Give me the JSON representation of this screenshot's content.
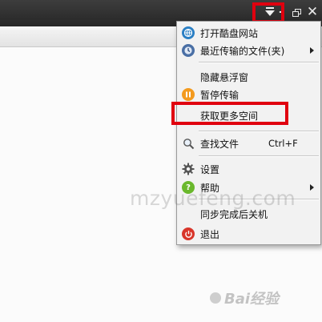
{
  "window_controls": {
    "menu": "dropdown-menu-icon",
    "minimize_label": "-",
    "restore": "restore-icon",
    "close_label": "✕"
  },
  "menu": {
    "items": [
      {
        "label": "打开酷盘网站",
        "icon": "globe-icon",
        "color": "#2a7fc4"
      },
      {
        "label": "最近传输的文件(夹)",
        "icon": "clock-icon",
        "color": "#4a6fa5",
        "submenu": true
      },
      {
        "label": "隐藏悬浮窗"
      },
      {
        "label": "暂停传输",
        "icon": "pause-icon",
        "color": "#f39a1e"
      },
      {
        "label": "获取更多空间"
      },
      {
        "label": "查找文件",
        "shortcut": "Ctrl+F",
        "icon": "search-icon"
      },
      {
        "label": "设置",
        "icon": "gear-icon"
      },
      {
        "label": "帮助",
        "icon": "help-icon",
        "color": "#6ab82c",
        "submenu": true
      },
      {
        "label": "同步完成后关机"
      },
      {
        "label": "退出",
        "icon": "power-icon",
        "color": "#d8352a"
      }
    ]
  },
  "highlight_color": "#e0000f",
  "watermark": "mzyuefeng.com",
  "logo_text": "Bai经验"
}
